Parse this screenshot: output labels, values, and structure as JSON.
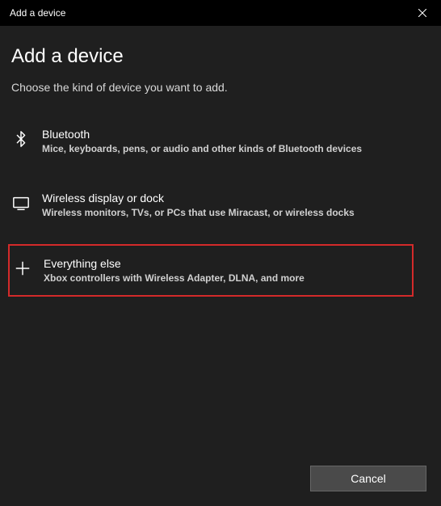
{
  "titlebar": {
    "title": "Add a device"
  },
  "main": {
    "heading": "Add a device",
    "subheading": "Choose the kind of device you want to add."
  },
  "options": [
    {
      "title": "Bluetooth",
      "desc": "Mice, keyboards, pens, or audio and other kinds of Bluetooth devices"
    },
    {
      "title": "Wireless display or dock",
      "desc": "Wireless monitors, TVs, or PCs that use Miracast, or wireless docks"
    },
    {
      "title": "Everything else",
      "desc": "Xbox controllers with Wireless Adapter, DLNA, and more"
    }
  ],
  "footer": {
    "cancel": "Cancel"
  }
}
